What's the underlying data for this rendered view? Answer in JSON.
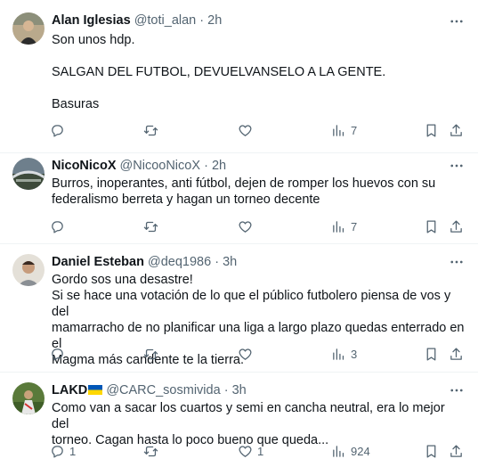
{
  "tweets": [
    {
      "name": "Alan Iglesias",
      "handle": "@toti_alan",
      "dot": "·",
      "time": "2h",
      "lines": [
        "Son unos hdp.",
        "",
        "SALGAN DEL FUTBOL, DEVUELVANSELO A LA GENTE.",
        "",
        "Basuras"
      ],
      "reply_count": "",
      "retweet_count": "",
      "like_count": "",
      "views": "7"
    },
    {
      "name": "NicoNicoX",
      "handle": "@NicooNicoX",
      "dot": "·",
      "time": "2h",
      "lines": [
        "Burros, inoperantes, anti fútbol, dejen de romper los huevos con su",
        "federalismo berreta y hagan un torneo decente"
      ],
      "reply_count": "",
      "retweet_count": "",
      "like_count": "",
      "views": "7"
    },
    {
      "name": "Daniel Esteban",
      "handle": "@deq1986",
      "dot": "·",
      "time": "3h",
      "lines": [
        "Gordo sos una desastre!",
        "Si se hace una votación de lo que el público futbolero piensa de vos y del",
        "mamarracho de no planificar una liga a largo plazo quedas enterrado en el",
        "Magma más candente te la tierra."
      ],
      "reply_count": "",
      "retweet_count": "",
      "like_count": "",
      "views": "3"
    },
    {
      "name": "LAKD",
      "handle": "@CARC_sosmivida",
      "dot": "·",
      "time": "3h",
      "lines": [
        "Como van a sacar los cuartos y semi en cancha neutral, era lo mejor del",
        "torneo. Cagan hasta lo poco bueno que queda..."
      ],
      "reply_count": "1",
      "retweet_count": "",
      "like_count": "1",
      "views": "924"
    }
  ],
  "icons": {
    "reply": "reply-icon",
    "retweet": "retweet-icon",
    "like": "like-icon",
    "views": "views-icon",
    "bookmark": "bookmark-icon",
    "share": "share-icon",
    "more": "more-icon",
    "flag": "ukraine-flag-icon"
  },
  "colors": {
    "text": "#0f1419",
    "secondary": "#536471",
    "divider": "#eff3f4",
    "flag_blue": "#0057b7",
    "flag_yellow": "#ffd700"
  }
}
